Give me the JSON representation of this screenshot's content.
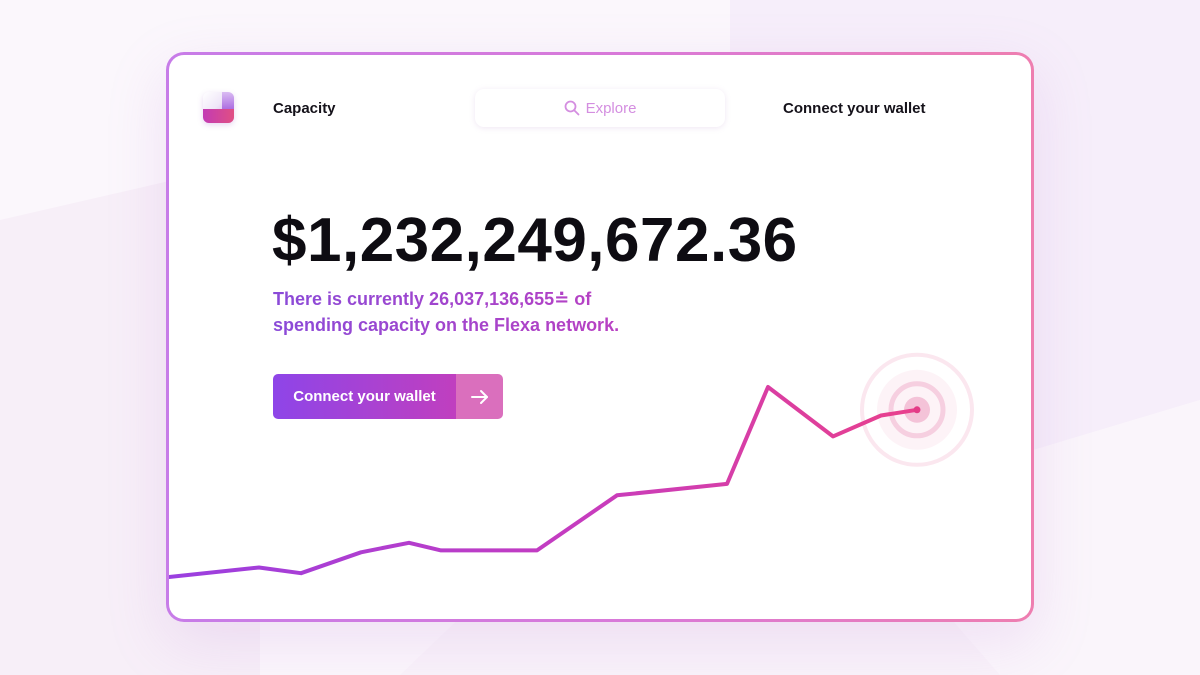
{
  "nav": {
    "title": "Capacity",
    "search_placeholder": "Explore",
    "connect_label": "Connect your wallet"
  },
  "hero": {
    "amount": "$1,232,249,672.36",
    "description_line1": "There is currently 26,037,136,655≐ of",
    "description_line2": "spending capacity on the Flexa network.",
    "cta_label": "Connect your wallet"
  },
  "icons": {
    "logo": "flexa-logo",
    "search": "search-icon",
    "cta_arrow": "arrow-right-icon",
    "endpoint": "pulse-dot-icon"
  },
  "colors": {
    "accent_purple": "#8e45e8",
    "accent_magenta": "#c03fbf",
    "accent_pink": "#e9468f",
    "text_dark": "#15121a"
  },
  "chart_data": {
    "type": "line",
    "title": "",
    "xlabel": "",
    "ylabel": "",
    "grid": false,
    "x": [
      0,
      1,
      2,
      3,
      4,
      5,
      6,
      7,
      8,
      9,
      10,
      11,
      12,
      13
    ],
    "ylim": [
      0,
      100
    ],
    "series": [
      {
        "values": [
          0,
          5,
          2,
          13,
          18,
          14,
          14,
          43,
          49,
          100,
          74,
          85,
          88,
          88
        ],
        "x": [
          0,
          90,
          132,
          192,
          240,
          272,
          368,
          448,
          558,
          599,
          664,
          712,
          748,
          748
        ]
      }
    ],
    "gradient": [
      "#9a3fe0",
      "#c63cbf",
      "#e9408c"
    ]
  }
}
